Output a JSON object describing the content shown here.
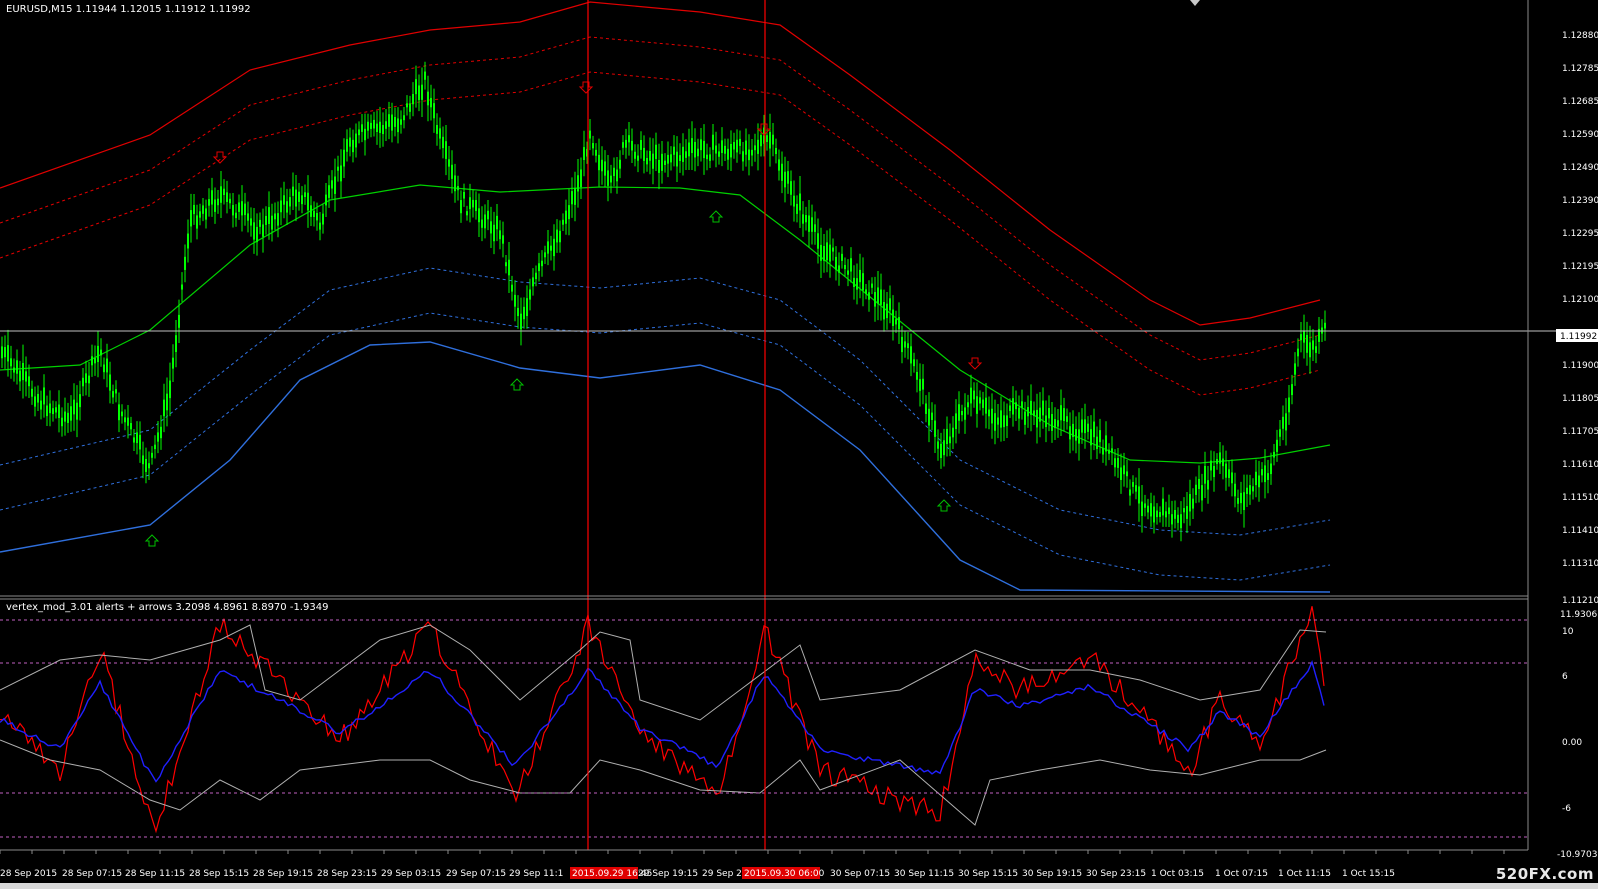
{
  "main_panel": {
    "header": "EURUSD,M15  1.11944 1.12015 1.11912 1.11992",
    "price_axis_labels": [
      "1.12880",
      "1.12785",
      "1.12685",
      "1.12590",
      "1.12490",
      "1.12390",
      "1.12295",
      "1.12195",
      "1.12100",
      "1.11900",
      "1.11805",
      "1.11705",
      "1.11610",
      "1.11510",
      "1.11410",
      "1.11310",
      "1.11210"
    ],
    "current_price": "1.11992"
  },
  "indicator_panel": {
    "header": "vertex_mod_3.01 alerts + arrows 3.2098 4.8961 8.8970 -1.9349",
    "axis_labels": {
      "max": "11.9306",
      "l10": "10",
      "l6": "6",
      "l0": "0.00",
      "lm6": "-6",
      "min": "-10.9703"
    }
  },
  "time_axis_labels": [
    "28 Sep 2015",
    "28 Sep 07:15",
    "28 Sep 11:15",
    "28 Sep 15:15",
    "28 Sep 19:15",
    "28 Sep 23:15",
    "29 Sep 03:15",
    "29 Sep 07:15",
    "29 Sep 11:1",
    "29 Sep 19:15",
    "29 Sep 2",
    "30 Sep 07:15",
    "30 Sep 11:15",
    "30 Sep 15:15",
    "30 Sep 19:15",
    "30 Sep 23:15",
    "1 Oct 03:15",
    "1 Oct 07:15",
    "1 Oct 11:15",
    "1 Oct 15:15"
  ],
  "vline_labels": [
    "2015.09.29 16:45",
    "2015.09.30 06:00"
  ],
  "watermark": "520FX.com",
  "colors": {
    "background": "#000000",
    "candles": "#00ff00",
    "mid_band": "#00d000",
    "upper_band": "#e00000",
    "lower_band": "#2f6fdc",
    "vertical_line": "#ff0000",
    "price_line": "#c0c0c0",
    "osc_red": "#ff0000",
    "osc_blue": "#2020ff",
    "osc_gray": "#b0b0b0",
    "level_line": "#c060c0",
    "up_arrow": "#00c000",
    "down_arrow": "#e00000"
  }
}
